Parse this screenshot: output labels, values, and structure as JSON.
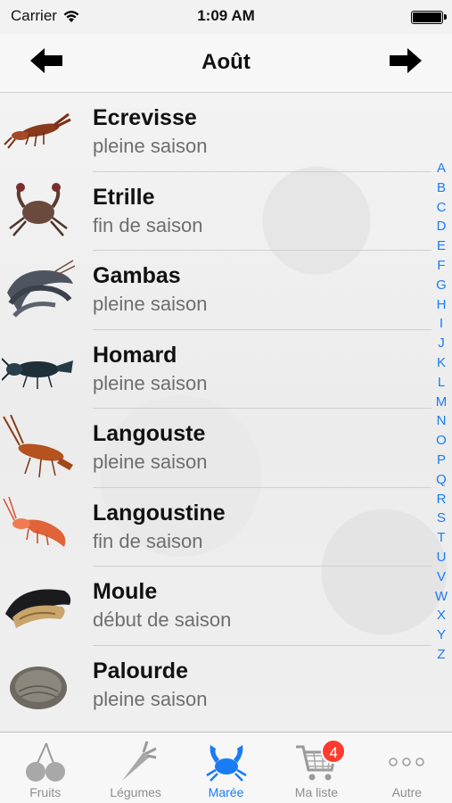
{
  "status_bar": {
    "carrier": "Carrier",
    "time": "1:09 AM"
  },
  "navbar": {
    "title": "Août",
    "back_icon": "arrow-left-icon",
    "forward_icon": "arrow-right-icon"
  },
  "items": [
    {
      "name": "Ecrevisse",
      "season": "pleine saison",
      "icon": "crayfish-icon"
    },
    {
      "name": "Etrille",
      "season": "fin de saison",
      "icon": "crab-icon"
    },
    {
      "name": "Gambas",
      "season": "pleine saison",
      "icon": "prawn-icon"
    },
    {
      "name": "Homard",
      "season": "pleine saison",
      "icon": "lobster-icon"
    },
    {
      "name": "Langouste",
      "season": "pleine saison",
      "icon": "spiny-lobster-icon"
    },
    {
      "name": "Langoustine",
      "season": "fin de saison",
      "icon": "langoustine-icon"
    },
    {
      "name": "Moule",
      "season": "début de saison",
      "icon": "mussel-icon"
    },
    {
      "name": "Palourde",
      "season": "pleine saison",
      "icon": "clam-icon"
    }
  ],
  "index_letters": [
    "A",
    "B",
    "C",
    "D",
    "E",
    "F",
    "G",
    "H",
    "I",
    "J",
    "K",
    "L",
    "M",
    "N",
    "O",
    "P",
    "Q",
    "R",
    "S",
    "T",
    "U",
    "V",
    "W",
    "X",
    "Y",
    "Z"
  ],
  "tabs": [
    {
      "label": "Fruits",
      "icon": "cherries-icon",
      "active": false
    },
    {
      "label": "Légumes",
      "icon": "carrot-icon",
      "active": false
    },
    {
      "label": "Marée",
      "icon": "crab-icon",
      "active": true
    },
    {
      "label": "Ma liste",
      "icon": "cart-icon",
      "active": false,
      "badge": "4"
    },
    {
      "label": "Autre",
      "icon": "more-icon",
      "active": false
    }
  ],
  "colors": {
    "accent": "#1a7cf5",
    "badge": "#ff3b30",
    "secondary_text": "#6e6e6e"
  }
}
